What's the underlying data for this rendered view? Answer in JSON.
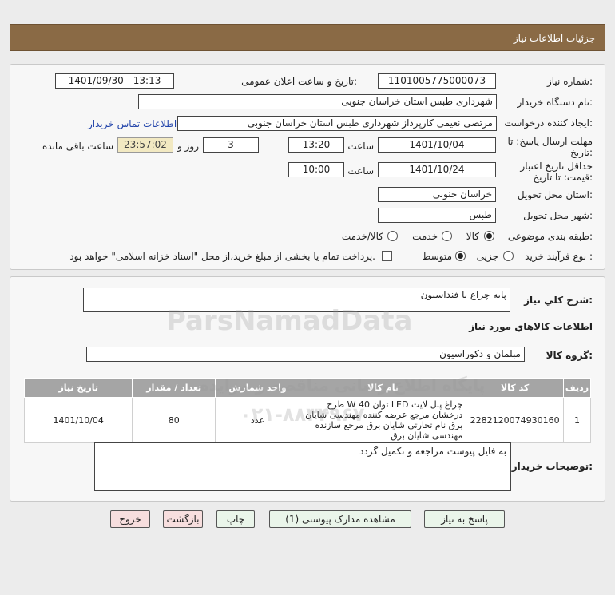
{
  "header": {
    "title": "جزئیات اطلاعات نیاز"
  },
  "form": {
    "need_number_label": "شماره نیاز:",
    "need_number": "1101005775000073",
    "announce_label": "تاریخ و ساعت اعلان عمومی:",
    "announce_value": "1401/09/30 - 13:13",
    "buyer_org_label": "نام دستگاه خریدار:",
    "buyer_org": "شهرداری طبس استان خراسان جنوبی",
    "creator_label": "ایجاد کننده درخواست:",
    "creator": "مرتضی نعیمی کارپرداز شهرداری طبس استان خراسان جنوبی",
    "contact_link": "اطلاعات تماس خریدار",
    "deadline_label_1": "مهلت ارسال پاسخ: تا",
    "deadline_label_2": "تاریخ:",
    "deadline_date": "1401/10/04",
    "time_label": "ساعت",
    "deadline_time": "13:20",
    "days": "3",
    "days_label": "روز و",
    "remaining_time": "23:57:02",
    "remaining_label": "ساعت باقی مانده",
    "validity_label_1": "حداقل تاریخ اعتبار",
    "validity_label_2": "قیمت: تا تاریخ:",
    "validity_date": "1401/10/24",
    "validity_time": "10:00",
    "province_label": "استان محل تحویل:",
    "province": "خراسان جنوبی",
    "city_label": "شهر محل تحویل:",
    "city": "طبس",
    "category_label": "طبقه بندی موضوعی:",
    "category_options": [
      "کالا",
      "خدمت",
      "کالا/خدمت"
    ],
    "category_selected": "کالا",
    "process_label": "نوع فرآیند خرید :",
    "process_options": [
      "جزیی",
      "متوسط"
    ],
    "process_selected": "متوسط",
    "payment_note": "پرداخت تمام یا بخشی از مبلغ خرید،از محل \"اسناد خزانه اسلامی\" خواهد بود."
  },
  "details": {
    "general_desc_label": "شرح کلي نياز:",
    "general_desc": "پایه چراغ با فنداسیون",
    "goods_info_title": "اطلاعات کالاهاي مورد نياز",
    "goods_group_label": "گروه کالا:",
    "goods_group": "مبلمان و دکوراسیون",
    "table": {
      "headers": [
        "ردیف",
        "کد کالا",
        "نام کالا",
        "واحد شمارش",
        "تعداد / مقدار",
        "تاریخ نیاز"
      ],
      "rows": [
        {
          "row": "1",
          "code": "2282120074930160",
          "name": "چراغ پنل لایت LED توان 40 W طرح درخشان مرجع عرضه کننده مهندسی شایان برق نام تجارتی شایان برق مرجع سازنده مهندسی شایان برق",
          "unit": "عدد",
          "qty": "80",
          "date": "1401/10/04"
        }
      ]
    },
    "buyer_notes_label": "توضیحات خریدار:",
    "buyer_notes": "به فایل پیوست مراجعه و تکمیل گردد"
  },
  "buttons": {
    "reply": "پاسخ به نیاز",
    "attachments": "مشاهده مدارک پیوستی (1)",
    "print": "چاپ",
    "back": "بازگشت",
    "exit": "خروج"
  },
  "watermark": {
    "brand": "ParsNamadData",
    "line1": "پایگاه اطلاع رسانی مناقصه و مزایده",
    "line2": "۰۲۱-۸۸۳۴۹۶۷۰"
  }
}
